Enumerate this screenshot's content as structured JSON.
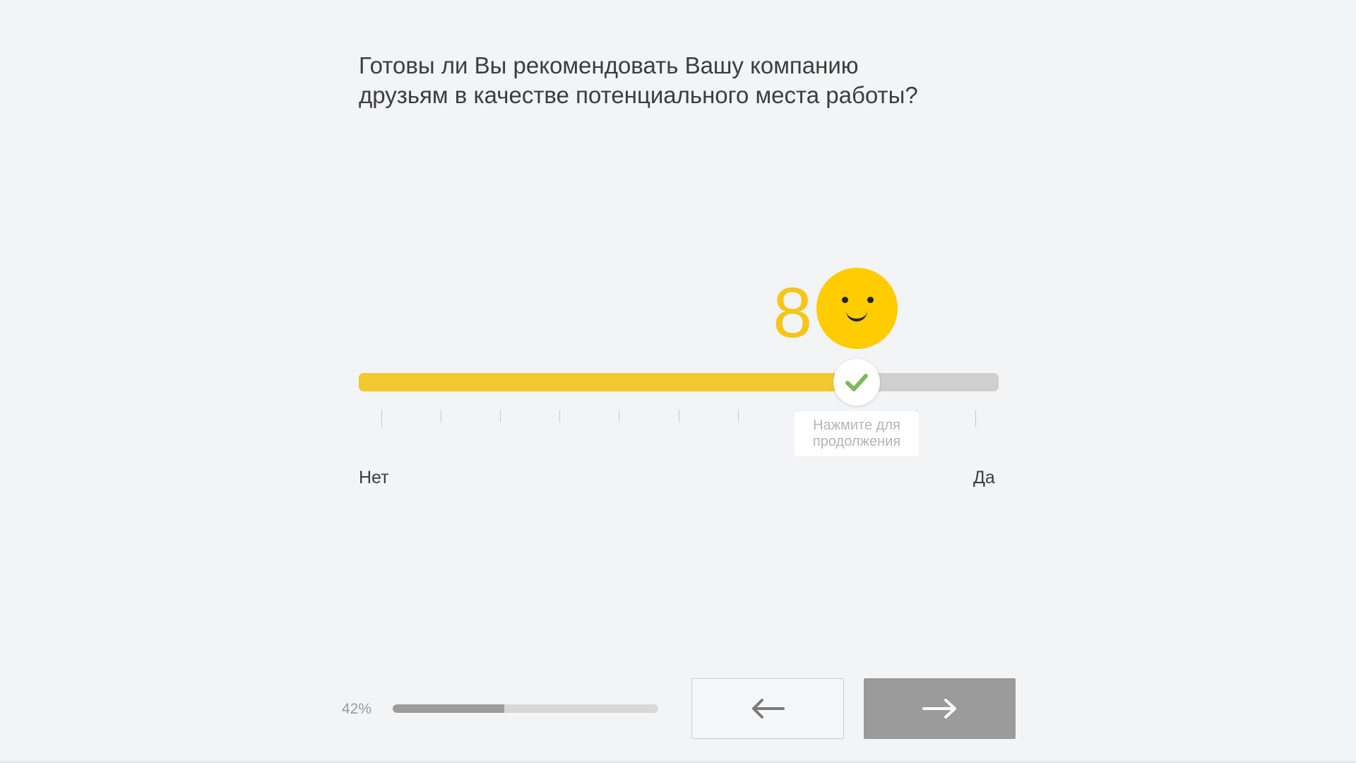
{
  "question": {
    "line1": "Готовы ли Вы рекомендовать Вашу компанию",
    "line2": "друзьям в качестве потенциального места работы?"
  },
  "rating": {
    "selected_value": "8",
    "selected_fraction": 0.78,
    "mood_icon": "smiley-face-icon",
    "confirm_icon": "checkmark-icon",
    "hint_line1": "Нажмите для",
    "hint_line2": "продолжения",
    "min_label": "Нет",
    "max_label": "Да",
    "tick_count": 11,
    "colors": {
      "fill": "#f2c92e",
      "track": "#cfcfcf",
      "smiley": "#ffcc00",
      "check": "#7cbb5b"
    }
  },
  "footer": {
    "progress_text": "42%",
    "progress_fraction": 0.42,
    "back_icon": "arrow-left-icon",
    "next_icon": "arrow-right-icon"
  }
}
